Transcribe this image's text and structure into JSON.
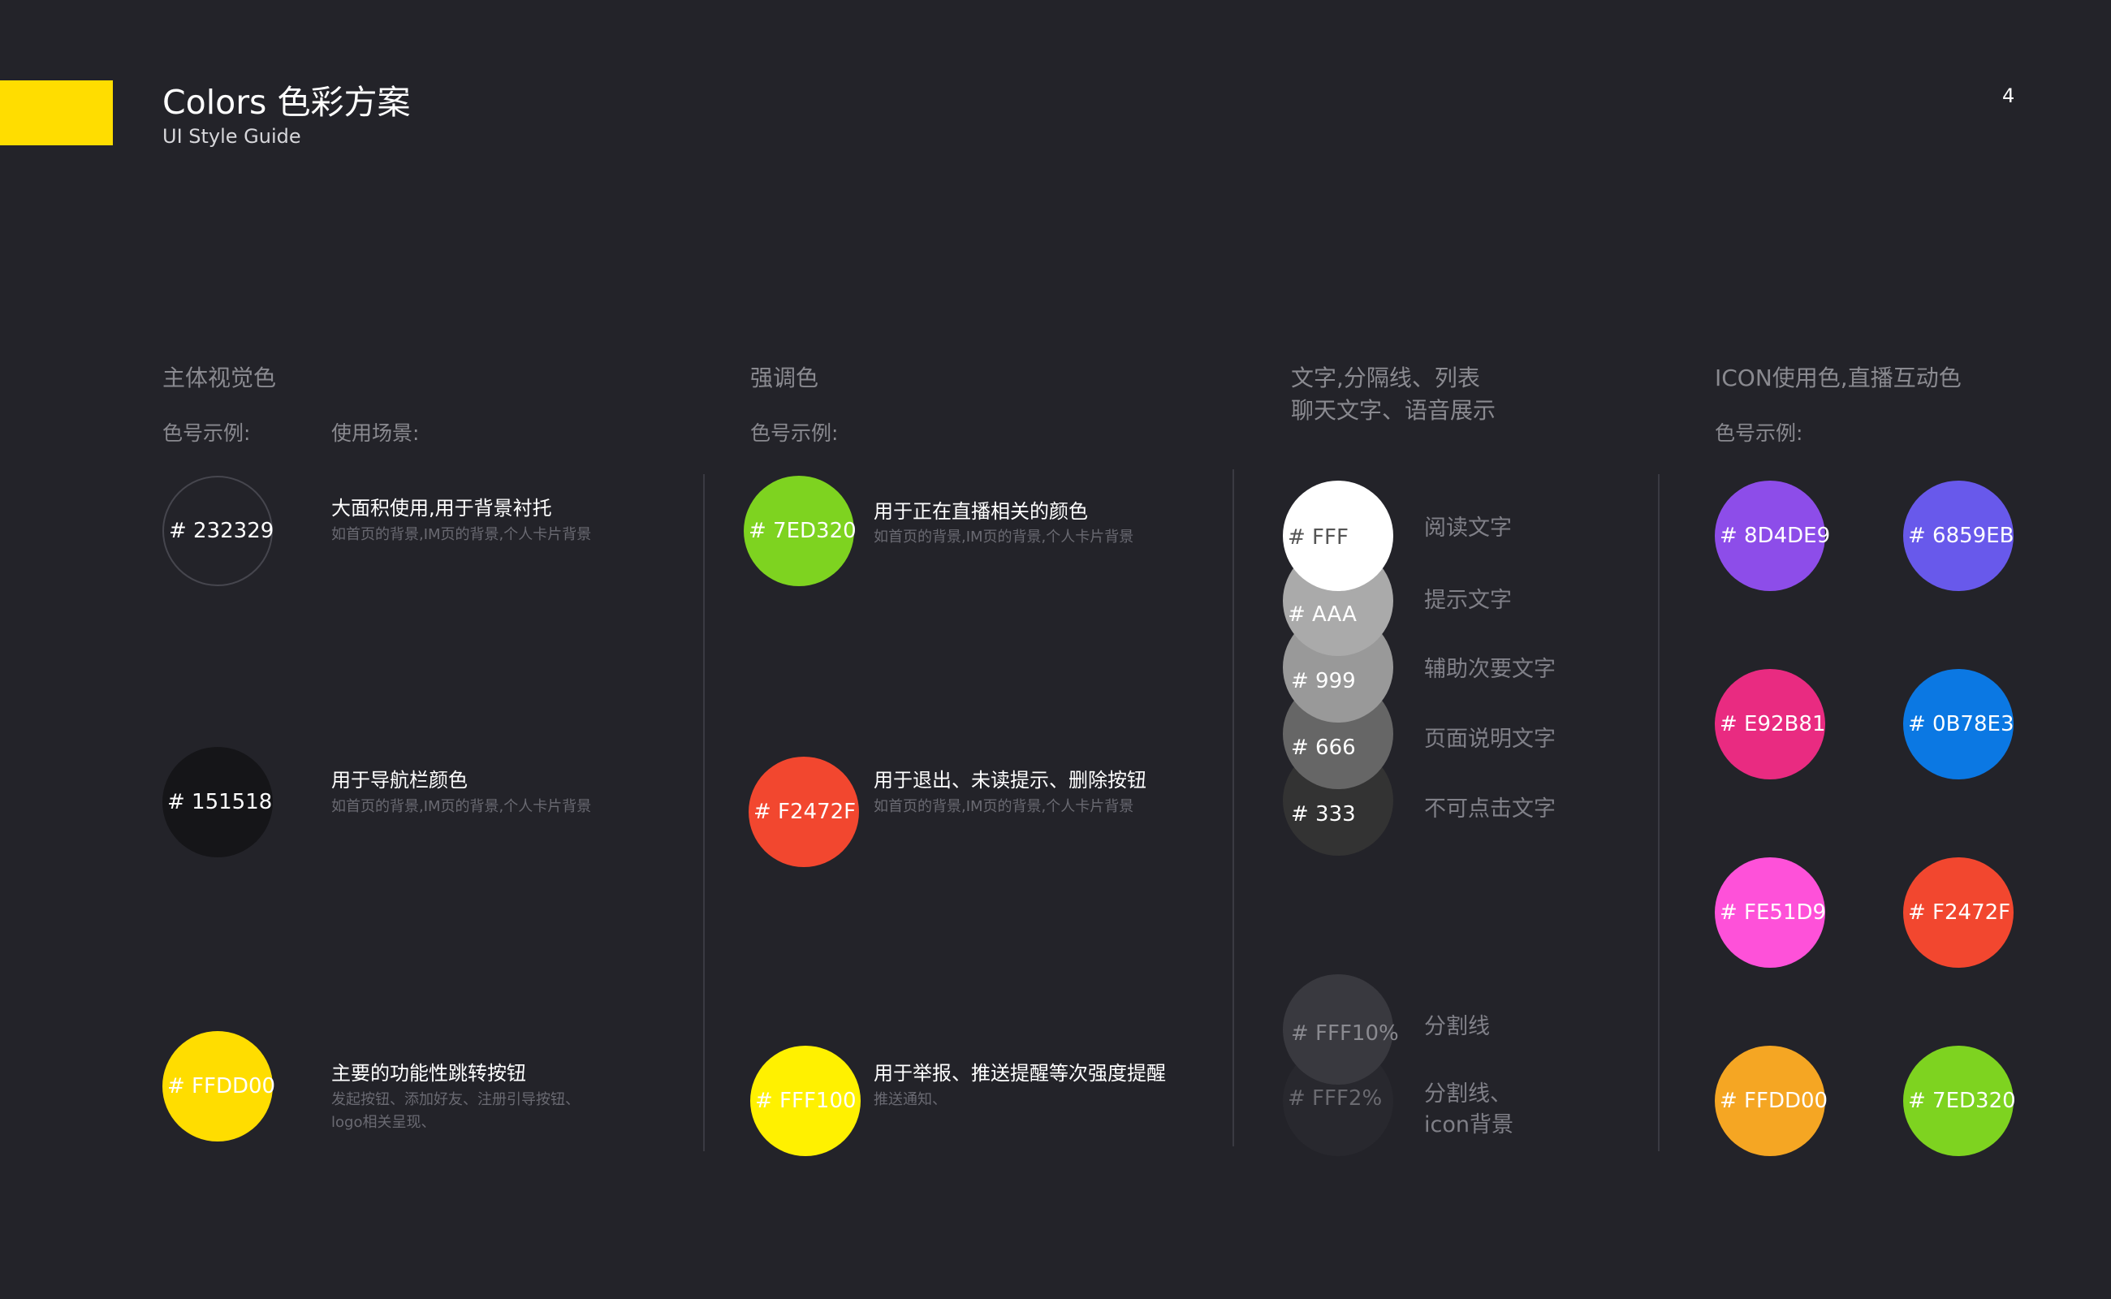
{
  "header": {
    "title": "Colors 色彩方案",
    "subtitle": "UI Style Guide",
    "page_number": "4"
  },
  "colors": {
    "background": "#232329",
    "accent": "#FFDD00"
  },
  "primary": {
    "heading": "主体视觉色",
    "example_label": "色号示例:",
    "usage_label": "使用场景:",
    "items": [
      {
        "code": "# 232329",
        "color": "#232329",
        "title": "大面积使用,用于背景衬托",
        "desc": "如首页的背景,IM页的背景,个人卡片背景"
      },
      {
        "code": "# 151518",
        "color": "#151518",
        "title": "用于导航栏颜色",
        "desc": "如首页的背景,IM页的背景,个人卡片背景"
      },
      {
        "code": "# FFDD00",
        "color": "#FFDD00",
        "title": "主要的功能性跳转按钮",
        "desc_line1": "发起按钮、添加好友、注册引导按钮、",
        "desc_line2": "logo相关呈现、"
      }
    ]
  },
  "accent_section": {
    "heading": "强调色",
    "example_label": "色号示例:",
    "items": [
      {
        "code": "# 7ED320",
        "color": "#7ED320",
        "title": "用于正在直播相关的颜色",
        "desc": "如首页的背景,IM页的背景,个人卡片背景"
      },
      {
        "code": "# F2472F",
        "color": "#F2472F",
        "title": "用于退出、未读提示、删除按钮",
        "desc": "如首页的背景,IM页的背景,个人卡片背景"
      },
      {
        "code": "# FFF100",
        "color": "#FFF100",
        "title": "用于举报、推送提醒等次强度提醒",
        "desc": "推送通知、"
      }
    ]
  },
  "text_section": {
    "heading_line1": "文字,分隔线、列表",
    "heading_line2": "聊天文字、语音展示",
    "items": [
      {
        "code": "# FFF",
        "color": "#FFFFFF",
        "label": "阅读文字"
      },
      {
        "code": "# AAA",
        "color": "#AAAAAA",
        "label": "提示文字"
      },
      {
        "code": "# 999",
        "color": "#999999",
        "label": "辅助次要文字"
      },
      {
        "code": "# 666",
        "color": "#666666",
        "label": "页面说明文字"
      },
      {
        "code": "# 333",
        "color": "#333333",
        "label": "不可点击文字"
      }
    ],
    "dividers": [
      {
        "code": "# FFF10%",
        "color": "#39393F",
        "label": "分割线"
      },
      {
        "code": "# FFF2%",
        "color": "#28282E",
        "label_line1": "分割线、",
        "label_line2": "icon背景"
      }
    ]
  },
  "icon_section": {
    "heading": "ICON使用色,直播互动色",
    "example_label": "色号示例:",
    "items": [
      {
        "code": "# 8D4DE9",
        "color": "#8D4DE9"
      },
      {
        "code": "# 6859EB",
        "color": "#6859EB"
      },
      {
        "code": "# E92B81",
        "color": "#E92B81"
      },
      {
        "code": "# 0B78E3",
        "color": "#0B78E3"
      },
      {
        "code": "# FE51D9",
        "color": "#FE51D9"
      },
      {
        "code": "# F2472F",
        "color": "#F2472F"
      },
      {
        "code": "# FFDD00",
        "color": "#F5A623"
      },
      {
        "code": "# 7ED320",
        "color": "#7ED320"
      }
    ]
  }
}
